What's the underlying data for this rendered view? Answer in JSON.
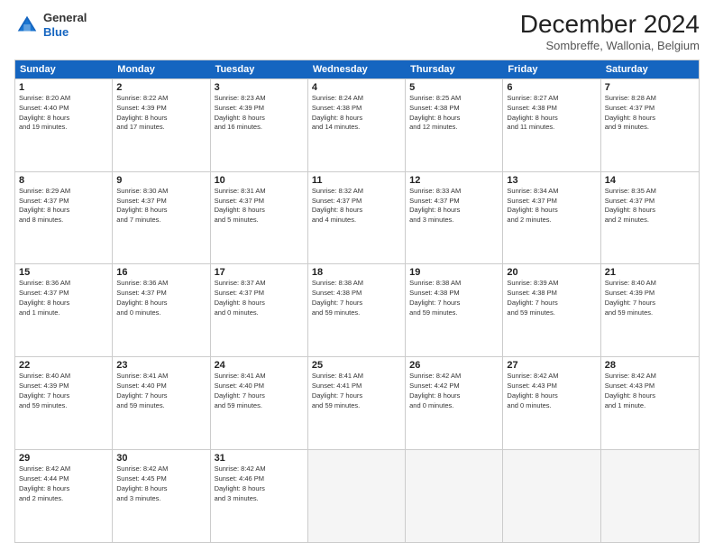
{
  "header": {
    "logo_general": "General",
    "logo_blue": "Blue",
    "month_title": "December 2024",
    "location": "Sombreffe, Wallonia, Belgium"
  },
  "days_of_week": [
    "Sunday",
    "Monday",
    "Tuesday",
    "Wednesday",
    "Thursday",
    "Friday",
    "Saturday"
  ],
  "rows": [
    [
      {
        "day": "1",
        "info": "Sunrise: 8:20 AM\nSunset: 4:40 PM\nDaylight: 8 hours\nand 19 minutes."
      },
      {
        "day": "2",
        "info": "Sunrise: 8:22 AM\nSunset: 4:39 PM\nDaylight: 8 hours\nand 17 minutes."
      },
      {
        "day": "3",
        "info": "Sunrise: 8:23 AM\nSunset: 4:39 PM\nDaylight: 8 hours\nand 16 minutes."
      },
      {
        "day": "4",
        "info": "Sunrise: 8:24 AM\nSunset: 4:38 PM\nDaylight: 8 hours\nand 14 minutes."
      },
      {
        "day": "5",
        "info": "Sunrise: 8:25 AM\nSunset: 4:38 PM\nDaylight: 8 hours\nand 12 minutes."
      },
      {
        "day": "6",
        "info": "Sunrise: 8:27 AM\nSunset: 4:38 PM\nDaylight: 8 hours\nand 11 minutes."
      },
      {
        "day": "7",
        "info": "Sunrise: 8:28 AM\nSunset: 4:37 PM\nDaylight: 8 hours\nand 9 minutes."
      }
    ],
    [
      {
        "day": "8",
        "info": "Sunrise: 8:29 AM\nSunset: 4:37 PM\nDaylight: 8 hours\nand 8 minutes."
      },
      {
        "day": "9",
        "info": "Sunrise: 8:30 AM\nSunset: 4:37 PM\nDaylight: 8 hours\nand 7 minutes."
      },
      {
        "day": "10",
        "info": "Sunrise: 8:31 AM\nSunset: 4:37 PM\nDaylight: 8 hours\nand 5 minutes."
      },
      {
        "day": "11",
        "info": "Sunrise: 8:32 AM\nSunset: 4:37 PM\nDaylight: 8 hours\nand 4 minutes."
      },
      {
        "day": "12",
        "info": "Sunrise: 8:33 AM\nSunset: 4:37 PM\nDaylight: 8 hours\nand 3 minutes."
      },
      {
        "day": "13",
        "info": "Sunrise: 8:34 AM\nSunset: 4:37 PM\nDaylight: 8 hours\nand 2 minutes."
      },
      {
        "day": "14",
        "info": "Sunrise: 8:35 AM\nSunset: 4:37 PM\nDaylight: 8 hours\nand 2 minutes."
      }
    ],
    [
      {
        "day": "15",
        "info": "Sunrise: 8:36 AM\nSunset: 4:37 PM\nDaylight: 8 hours\nand 1 minute."
      },
      {
        "day": "16",
        "info": "Sunrise: 8:36 AM\nSunset: 4:37 PM\nDaylight: 8 hours\nand 0 minutes."
      },
      {
        "day": "17",
        "info": "Sunrise: 8:37 AM\nSunset: 4:37 PM\nDaylight: 8 hours\nand 0 minutes."
      },
      {
        "day": "18",
        "info": "Sunrise: 8:38 AM\nSunset: 4:38 PM\nDaylight: 7 hours\nand 59 minutes."
      },
      {
        "day": "19",
        "info": "Sunrise: 8:38 AM\nSunset: 4:38 PM\nDaylight: 7 hours\nand 59 minutes."
      },
      {
        "day": "20",
        "info": "Sunrise: 8:39 AM\nSunset: 4:38 PM\nDaylight: 7 hours\nand 59 minutes."
      },
      {
        "day": "21",
        "info": "Sunrise: 8:40 AM\nSunset: 4:39 PM\nDaylight: 7 hours\nand 59 minutes."
      }
    ],
    [
      {
        "day": "22",
        "info": "Sunrise: 8:40 AM\nSunset: 4:39 PM\nDaylight: 7 hours\nand 59 minutes."
      },
      {
        "day": "23",
        "info": "Sunrise: 8:41 AM\nSunset: 4:40 PM\nDaylight: 7 hours\nand 59 minutes."
      },
      {
        "day": "24",
        "info": "Sunrise: 8:41 AM\nSunset: 4:40 PM\nDaylight: 7 hours\nand 59 minutes."
      },
      {
        "day": "25",
        "info": "Sunrise: 8:41 AM\nSunset: 4:41 PM\nDaylight: 7 hours\nand 59 minutes."
      },
      {
        "day": "26",
        "info": "Sunrise: 8:42 AM\nSunset: 4:42 PM\nDaylight: 8 hours\nand 0 minutes."
      },
      {
        "day": "27",
        "info": "Sunrise: 8:42 AM\nSunset: 4:43 PM\nDaylight: 8 hours\nand 0 minutes."
      },
      {
        "day": "28",
        "info": "Sunrise: 8:42 AM\nSunset: 4:43 PM\nDaylight: 8 hours\nand 1 minute."
      }
    ],
    [
      {
        "day": "29",
        "info": "Sunrise: 8:42 AM\nSunset: 4:44 PM\nDaylight: 8 hours\nand 2 minutes."
      },
      {
        "day": "30",
        "info": "Sunrise: 8:42 AM\nSunset: 4:45 PM\nDaylight: 8 hours\nand 3 minutes."
      },
      {
        "day": "31",
        "info": "Sunrise: 8:42 AM\nSunset: 4:46 PM\nDaylight: 8 hours\nand 3 minutes."
      },
      {
        "day": "",
        "info": ""
      },
      {
        "day": "",
        "info": ""
      },
      {
        "day": "",
        "info": ""
      },
      {
        "day": "",
        "info": ""
      }
    ]
  ]
}
